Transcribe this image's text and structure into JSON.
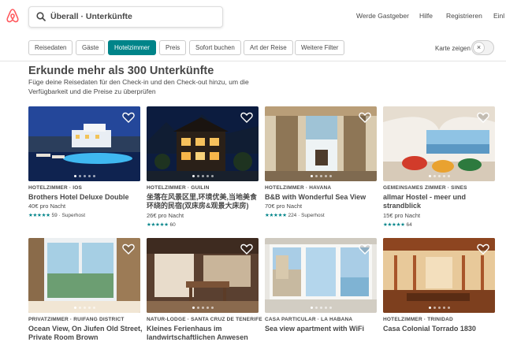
{
  "header": {
    "search_value": "Überall · Unterkünfte",
    "nav": [
      "Werde Gastgeber",
      "Hilfe",
      "Registrieren",
      "Einl"
    ]
  },
  "filters": {
    "chips": [
      "Reisedaten",
      "Gäste",
      "Hotelzimmer",
      "Preis",
      "Sofort buchen",
      "Art der Reise",
      "Weitere Filter"
    ],
    "active_index": 2,
    "map_label": "Karte zeigen",
    "map_toggle_icon": "×"
  },
  "main": {
    "heading": "Erkunde mehr als 300 Unterkünfte",
    "subheading": "Füge deine Reisedaten für den Check-in und den Check-out hinzu, um die Verfügbarkeit und die Preise zu überprüfen"
  },
  "colors": {
    "brand": "#FF5A5F",
    "accent": "#008489"
  },
  "listings": [
    {
      "kicker": "HOTELZIMMER · IOS",
      "title": "Brothers Hotel Deluxe Double",
      "price": "40€ pro Nacht",
      "stars": "★★★★★",
      "rating": "59 · Superhost"
    },
    {
      "kicker": "HOTELZIMMER · GUILIN",
      "title": "坐落在风景区里,环境优美,当地美食环绕的民宿(双床房&观景大床房)",
      "price": "26€ pro Nacht",
      "stars": "★★★★★",
      "rating": "60"
    },
    {
      "kicker": "HOTELZIMMER · HAVANA",
      "title": "B&B with Wonderful Sea View",
      "price": "70€ pro Nacht",
      "stars": "★★★★★",
      "rating": "224 · Superhost"
    },
    {
      "kicker": "GEMEINSAMES ZIMMER · SINES",
      "title": "allmar Hostel - meer und strandblick",
      "price": "15€ pro Nacht",
      "stars": "★★★★★",
      "rating": "64"
    },
    {
      "kicker": "PRIVATZIMMER · RUIFANG DISTRICT",
      "title": "Ocean View, On Jiufen Old Street, Private Room Brown",
      "price": "",
      "stars": "",
      "rating": ""
    },
    {
      "kicker": "NATUR-LODGE · SANTA CRUZ DE TENERIFE",
      "title": "Kleines Ferienhaus im landwirtschaftlichen Anwesen",
      "price": "",
      "stars": "",
      "rating": ""
    },
    {
      "kicker": "CASA PARTICULAR · LA HABANA",
      "title": "Sea view apartment with WiFi",
      "price": "",
      "stars": "",
      "rating": ""
    },
    {
      "kicker": "HOTELZIMMER · TRINIDAD",
      "title": "Casa Colonial Torrado 1830",
      "price": "",
      "stars": "",
      "rating": ""
    }
  ]
}
